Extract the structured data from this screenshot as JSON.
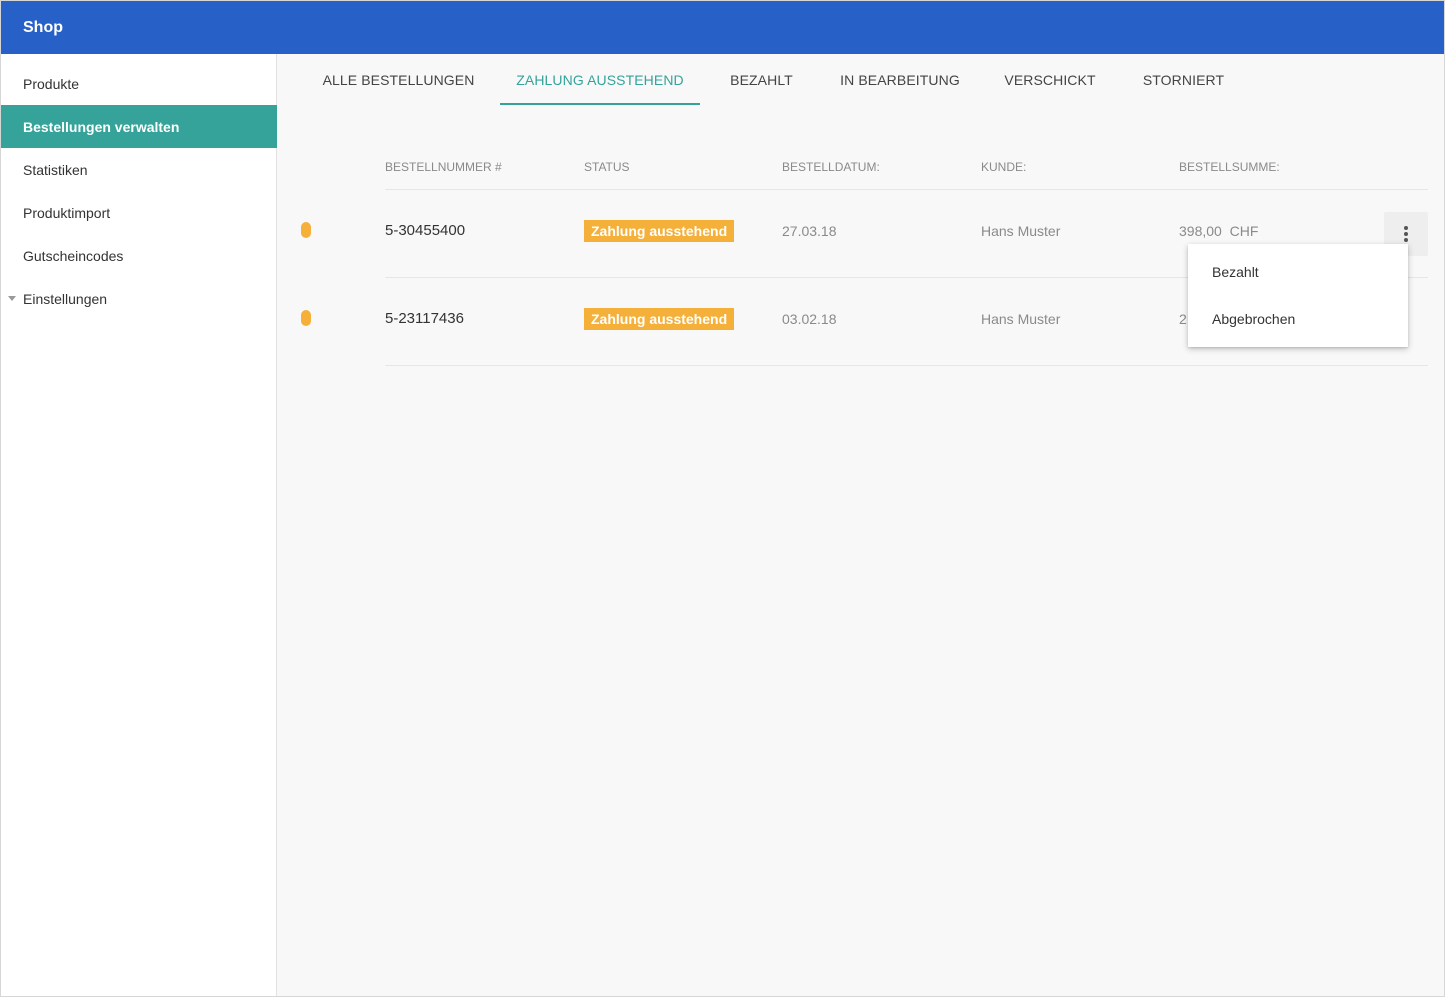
{
  "app": {
    "title": "Shop"
  },
  "sidebar": {
    "items": [
      {
        "label": "Produkte"
      },
      {
        "label": "Bestellungen verwalten",
        "active": true
      },
      {
        "label": "Statistiken"
      },
      {
        "label": "Produktimport"
      },
      {
        "label": "Gutscheincodes"
      },
      {
        "label": "Einstellungen",
        "expandable": true
      }
    ]
  },
  "tabs": [
    {
      "label": "ALLE BESTELLUNGEN"
    },
    {
      "label": "ZAHLUNG AUSSTEHEND",
      "active": true
    },
    {
      "label": "BEZAHLT"
    },
    {
      "label": "IN BEARBEITUNG"
    },
    {
      "label": "VERSCHICKT"
    },
    {
      "label": "STORNIERT"
    }
  ],
  "table": {
    "headers": {
      "number": "BESTELLNUMMER #",
      "status": "STATUS",
      "date": "BESTELLDATUM:",
      "customer": "KUNDE:",
      "total": "BESTELLSUMME:"
    },
    "rows": [
      {
        "number": "5-30455400",
        "status": "Zahlung ausstehend",
        "date": "27.03.18",
        "customer": "Hans Muster",
        "total": "398,00  CHF"
      },
      {
        "number": "5-23117436",
        "status": "Zahlung ausstehend",
        "date": "03.02.18",
        "customer": "Hans Muster",
        "total_partial": "2"
      }
    ]
  },
  "context_menu": {
    "items": [
      {
        "label": "Bezahlt"
      },
      {
        "label": "Abgebrochen"
      }
    ]
  },
  "icons": {
    "more": "more-vert-icon",
    "caret": "caret-down-icon",
    "status_indicator": "status-dot"
  },
  "colors": {
    "header_bg": "#2761c8",
    "accent": "#35a39a",
    "badge": "#f5b03a",
    "content_bg": "#f8f8f8"
  }
}
